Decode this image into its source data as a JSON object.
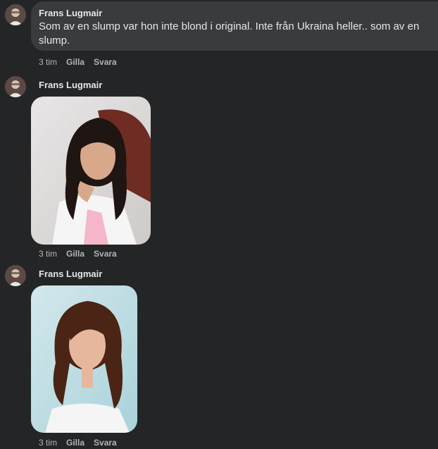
{
  "comments": [
    {
      "author": "Frans Lugmair",
      "text": "Som av en slump var hon inte blond i original. Inte från Ukraina heller.. som av en slump.",
      "time": "3 tim",
      "like": "Gilla",
      "reply": "Svara"
    },
    {
      "author": "Frans Lugmair",
      "time": "3 tim",
      "like": "Gilla",
      "reply": "Svara"
    },
    {
      "author": "Frans Lugmair",
      "time": "3 tim",
      "like": "Gilla",
      "reply": "Svara"
    }
  ],
  "colors": {
    "background": "#242526",
    "bubble": "#3a3b3c",
    "text": "#e4e6eb",
    "secondary_text": "#b0b3b8"
  }
}
